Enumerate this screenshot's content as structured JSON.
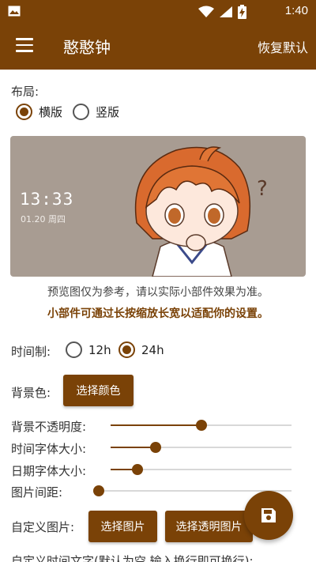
{
  "colors": {
    "primary": "#7a4207",
    "preview_bg": "#a89c92"
  },
  "status_bar": {
    "time": "1:40",
    "icons": [
      "image-icon",
      "wifi-icon",
      "signal-icon",
      "battery-charging-icon"
    ]
  },
  "app_bar": {
    "title": "憨憨钟",
    "action": "恢复默认"
  },
  "layout": {
    "label": "布局:",
    "options": [
      {
        "label": "横版",
        "selected": true
      },
      {
        "label": "竖版",
        "selected": false
      }
    ]
  },
  "preview": {
    "time": "13:33",
    "date": "01.20 周四"
  },
  "notes": {
    "hint": "预览图仅为参考，请以实际小部件效果为准。",
    "tip": "小部件可通过长按缩放长宽以适配你的设置。"
  },
  "time_format": {
    "label": "时间制:",
    "options": [
      {
        "label": "12h",
        "selected": false
      },
      {
        "label": "24h",
        "selected": true
      }
    ]
  },
  "background_color": {
    "label": "背景色:",
    "button": "选择颜色"
  },
  "sliders": [
    {
      "label": "背景不透明度:",
      "value": 0.5
    },
    {
      "label": "时间字体大小:",
      "value": 0.25
    },
    {
      "label": "日期字体大小:",
      "value": 0.15
    },
    {
      "label": "图片间距:",
      "value": 0.0
    }
  ],
  "custom_image": {
    "label": "自定义图片:",
    "button_image": "选择图片",
    "button_transparent": "选择透明图片"
  },
  "custom_time_text": {
    "label": "自定义时间文字(默认为空,输入换行即可换行):"
  },
  "fab": {
    "icon": "save-icon"
  }
}
